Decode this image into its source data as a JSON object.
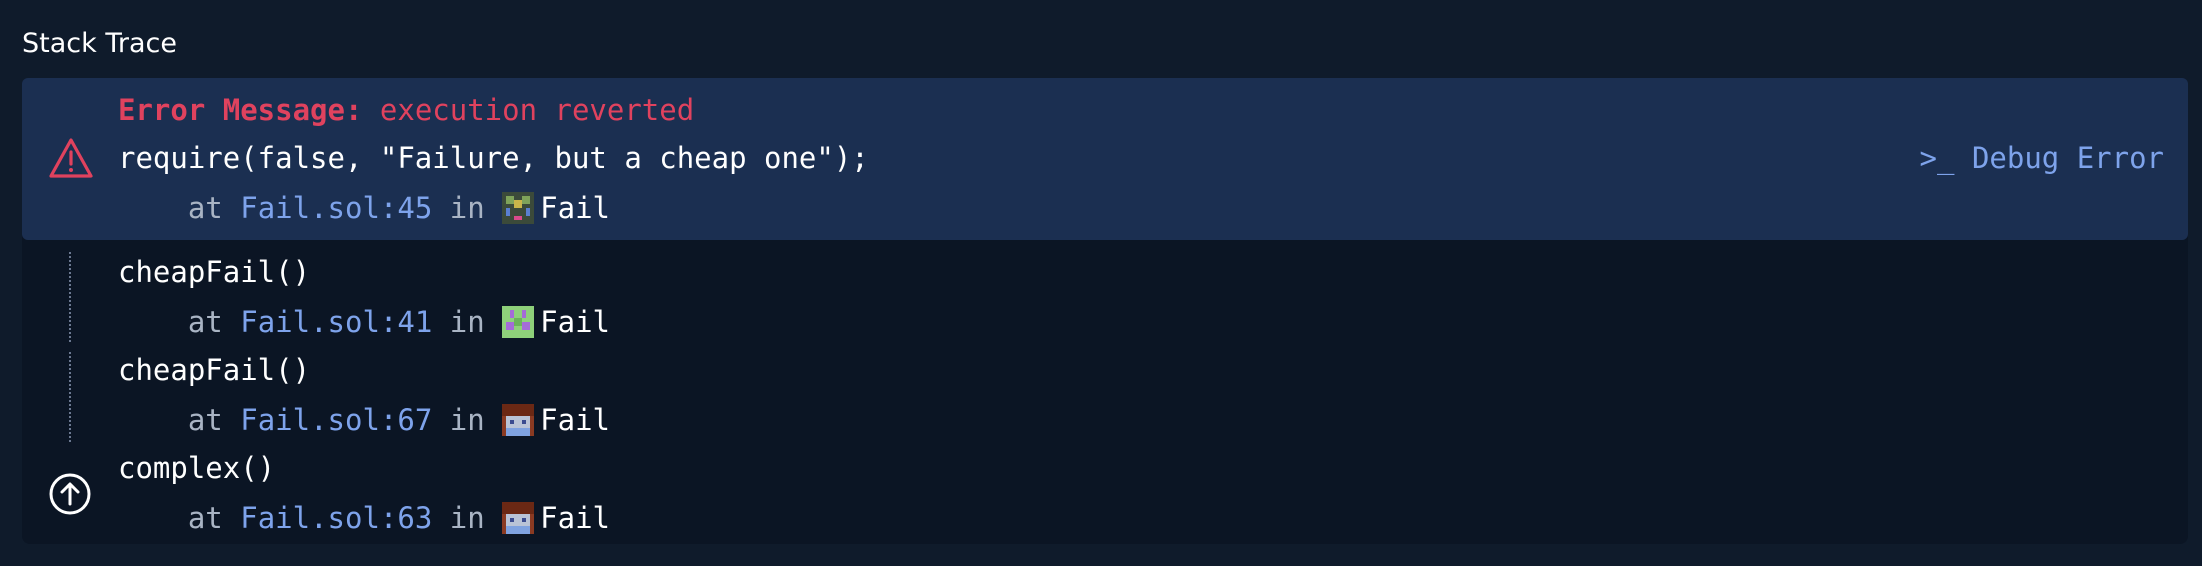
{
  "header": {
    "title": "Stack Trace"
  },
  "error": {
    "label": "Error Message:",
    "message": "execution reverted",
    "code": "require(false, \"Failure, but a cheap one\");",
    "at": "at",
    "in": "in",
    "location": "Fail.sol:45",
    "contract": "Fail",
    "debug_label": "Debug Error"
  },
  "frames": [
    {
      "call": "cheapFail()",
      "at": "at",
      "location": "Fail.sol:41",
      "in": "in",
      "contract": "Fail"
    },
    {
      "call": "cheapFail()",
      "at": "at",
      "location": "Fail.sol:67",
      "in": "in",
      "contract": "Fail"
    },
    {
      "call": "complex()",
      "at": "at",
      "location": "Fail.sol:63",
      "in": "in",
      "contract": "Fail"
    }
  ],
  "colors": {
    "background": "#0f1b2b",
    "panel": "#0b1524",
    "error_block": "#1b2f51",
    "error_red": "#e0425e",
    "link_blue": "#7ea3eb",
    "muted": "#a9b4c4"
  },
  "icons": {
    "warning": "warning-triangle-icon",
    "debug": "terminal-prompt-icon",
    "up": "arrow-up-circle-icon",
    "contract": "contract-identicon"
  }
}
